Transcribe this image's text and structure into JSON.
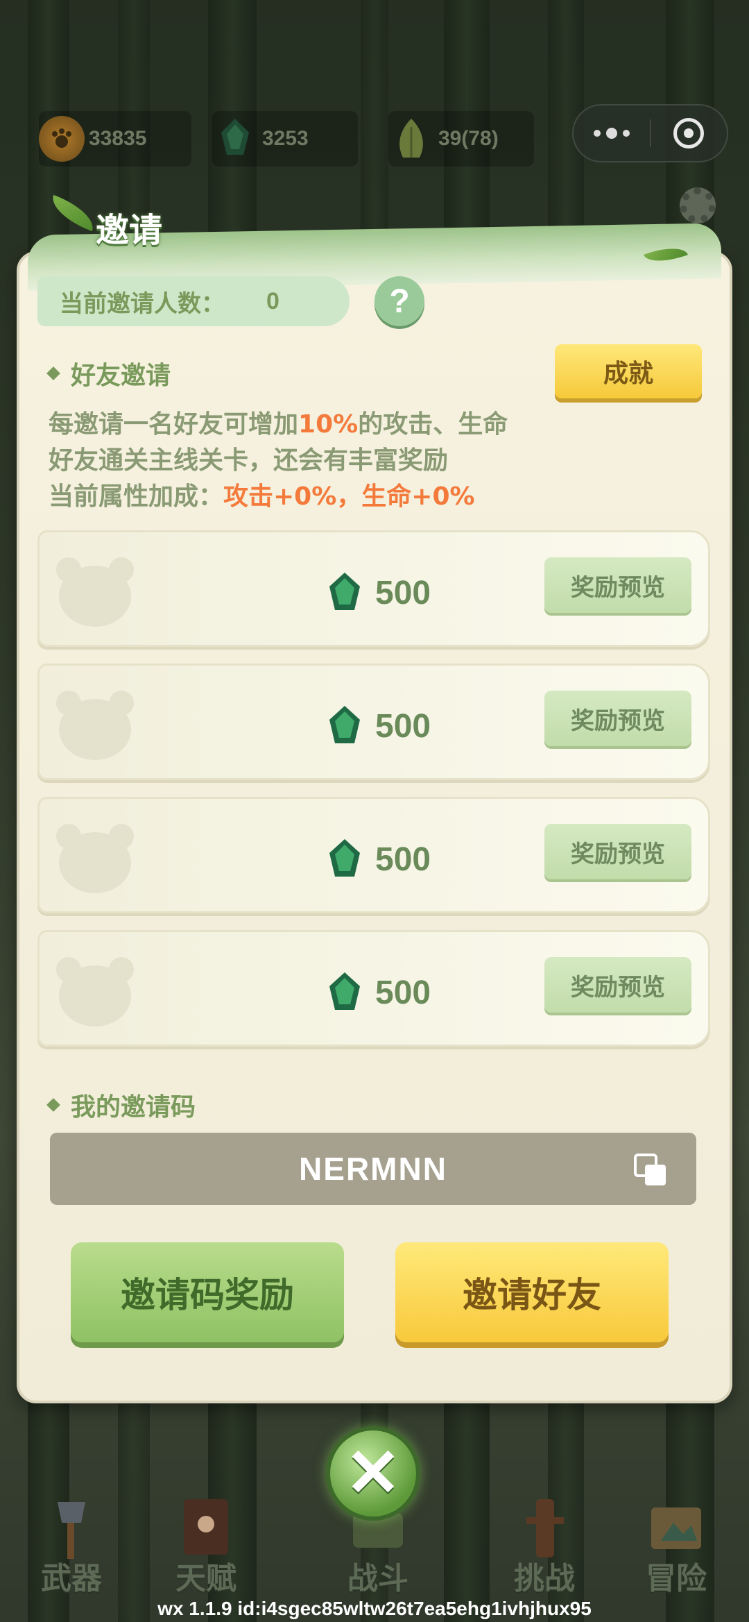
{
  "currencies": [
    {
      "icon": "paw-coin-icon",
      "value": "33835"
    },
    {
      "icon": "green-gem-icon",
      "value": "3253"
    },
    {
      "icon": "bamboo-shoot-icon",
      "value": "39(78)"
    }
  ],
  "capsule": {
    "more_icon": "more-dots-icon",
    "close_icon": "target-circle-icon"
  },
  "panel": {
    "title": "邀请",
    "invite_count_label": "当前邀请人数：",
    "invite_count_value": "0",
    "help_label": "?",
    "friend_section_title": "好友邀请",
    "achievement_label": "成就",
    "desc_line1_a": "每邀请一名好友可增加",
    "desc_line1_b": "10%",
    "desc_line1_c": "的攻击、生命",
    "desc_line2": "好友通关主线关卡，还会有丰富奖励",
    "desc_line3_a": "当前属性加成：",
    "desc_line3_b": "攻击+0%，生命+0%",
    "rewards": [
      {
        "amount": "500",
        "preview_label": "奖励预览"
      },
      {
        "amount": "500",
        "preview_label": "奖励预览"
      },
      {
        "amount": "500",
        "preview_label": "奖励预览"
      },
      {
        "amount": "500",
        "preview_label": "奖励预览"
      }
    ],
    "code_section_title": "我的邀请码",
    "invite_code": "NERMNN",
    "code_reward_button": "邀请码奖励",
    "invite_friend_button": "邀请好友"
  },
  "close_label": "✕",
  "nav": [
    {
      "label": "武器",
      "icon": "axe-icon"
    },
    {
      "label": "天赋",
      "icon": "book-icon"
    },
    {
      "label": "战斗",
      "icon": "scroll-icon"
    },
    {
      "label": "挑战",
      "icon": "wooden-dummy-icon"
    },
    {
      "label": "冒险",
      "icon": "map-icon"
    }
  ],
  "version_text": "wx  1.1.9 id:i4sgec85wltw26t7ea5ehg1ivhjhux95",
  "colors": {
    "accent_green": "#7a9a5c",
    "highlight_orange": "#f47a3c",
    "yellow_button": "#f8c93b"
  }
}
